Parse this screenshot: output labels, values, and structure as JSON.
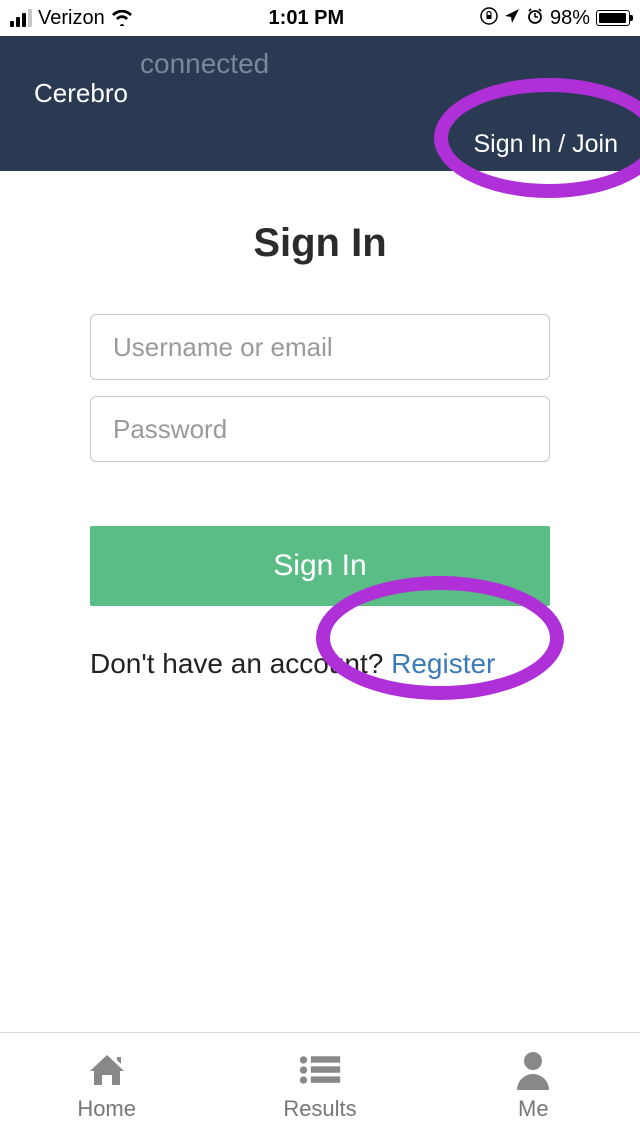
{
  "statusBar": {
    "carrier": "Verizon",
    "time": "1:01 PM",
    "batteryPct": "98%"
  },
  "header": {
    "connected": "connected",
    "brand": "Cerebro",
    "signInJoin": "Sign In / Join"
  },
  "form": {
    "title": "Sign In",
    "usernamePlaceholder": "Username or email",
    "passwordPlaceholder": "Password",
    "submitLabel": "Sign In",
    "noAccountText": "Don't have an account? ",
    "registerLabel": "Register"
  },
  "tabs": {
    "home": "Home",
    "results": "Results",
    "me": "Me"
  }
}
